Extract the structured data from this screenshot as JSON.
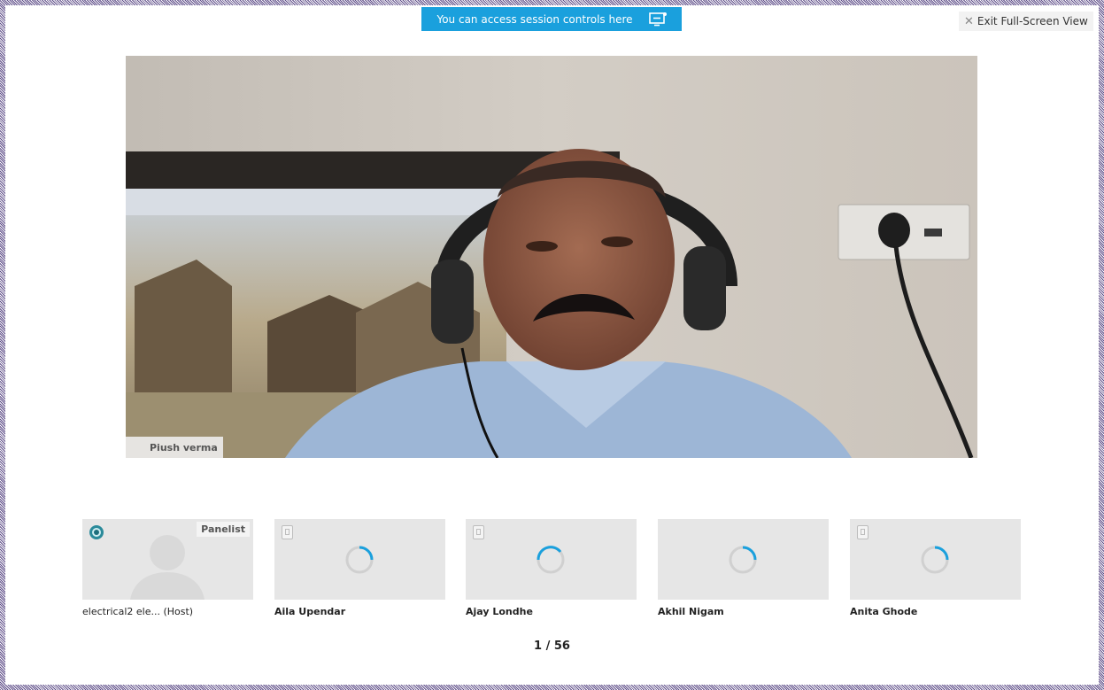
{
  "banner": {
    "text": "You can access session controls here",
    "icon": "session-controls-icon"
  },
  "exit_fullscreen": {
    "icon": "close-icon",
    "label": "Exit Full-Screen View"
  },
  "main_video": {
    "participant_name": "Piush verma"
  },
  "thumbnails": [
    {
      "name": "electrical2 ele... (Host)",
      "badge": "Panelist",
      "state": "avatar"
    },
    {
      "name": "Aila Upendar",
      "state": "loading"
    },
    {
      "name": "Ajay Londhe",
      "state": "loading"
    },
    {
      "name": "Akhil Nigam",
      "state": "loading"
    },
    {
      "name": "Anita Ghode",
      "state": "loading"
    }
  ],
  "pager": {
    "text": "1 / 56"
  },
  "colors": {
    "accent": "#1aa0dd",
    "tile_bg": "#e6e6e6"
  }
}
